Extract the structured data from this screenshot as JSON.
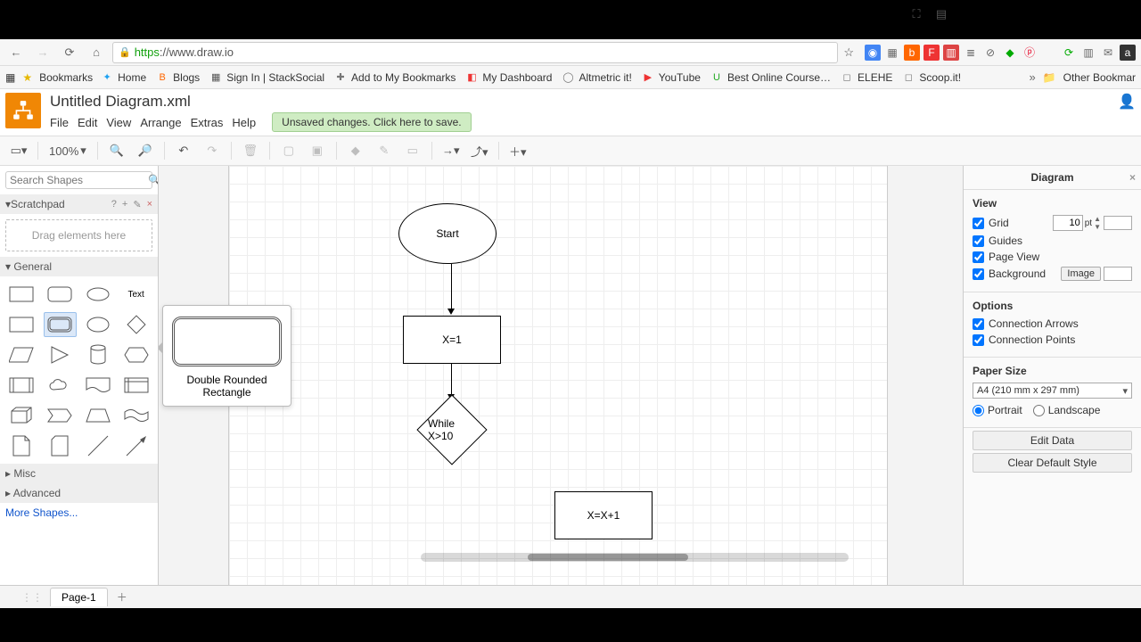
{
  "browser": {
    "url_scheme": "https",
    "url_rest": "://www.draw.io",
    "bookmarks_label": "Bookmarks",
    "other_bookmarks": "Other Bookmar",
    "bar": [
      {
        "label": "Home",
        "color": "#1da1f2",
        "glyph": "✦"
      },
      {
        "label": "Blogs",
        "color": "#f60",
        "glyph": "B"
      },
      {
        "label": "Sign In | StackSocial",
        "color": "#555",
        "glyph": "▦"
      },
      {
        "label": "Add to My Bookmarks",
        "color": "#777",
        "glyph": "✚"
      },
      {
        "label": "My Dashboard",
        "color": "#e33",
        "glyph": "◧"
      },
      {
        "label": "Altmetric it!",
        "color": "#777",
        "glyph": "◯"
      },
      {
        "label": "YouTube",
        "color": "#e33",
        "glyph": "▶"
      },
      {
        "label": "Best Online Course…",
        "color": "#2a2",
        "glyph": "U"
      },
      {
        "label": "ELEHE",
        "color": "#777",
        "glyph": "◻"
      },
      {
        "label": "Scoop.it!",
        "color": "#777",
        "glyph": "◻"
      }
    ]
  },
  "app": {
    "title": "Untitled Diagram.xml",
    "menus": [
      "File",
      "Edit",
      "View",
      "Arrange",
      "Extras",
      "Help"
    ],
    "save_notice": "Unsaved changes. Click here to save."
  },
  "toolbar": {
    "zoom": "100%"
  },
  "sidebar": {
    "search_placeholder": "Search Shapes",
    "scratchpad": "Scratchpad",
    "drag_hint": "Drag elements here",
    "sections": {
      "general": "General",
      "misc": "Misc",
      "advanced": "Advanced"
    },
    "more": "More Shapes...",
    "shape_text_label": "Text",
    "tooltip": "Double Rounded Rectangle"
  },
  "canvas": {
    "start": "Start",
    "assign": "X=1",
    "cond": "While X>10",
    "step": "X=X+1"
  },
  "rpanel": {
    "tab": "Diagram",
    "view": "View",
    "grid": "Grid",
    "grid_val": "10",
    "grid_unit": "pt",
    "guides": "Guides",
    "pageview": "Page View",
    "background": "Background",
    "image_btn": "Image",
    "options": "Options",
    "conn_arrows": "Connection Arrows",
    "conn_points": "Connection Points",
    "paper": "Paper Size",
    "paper_val": "A4 (210 mm x 297 mm)",
    "portrait": "Portrait",
    "landscape": "Landscape",
    "edit_data": "Edit Data",
    "clear_style": "Clear Default Style"
  },
  "page_tabs": {
    "p1": "Page-1"
  }
}
